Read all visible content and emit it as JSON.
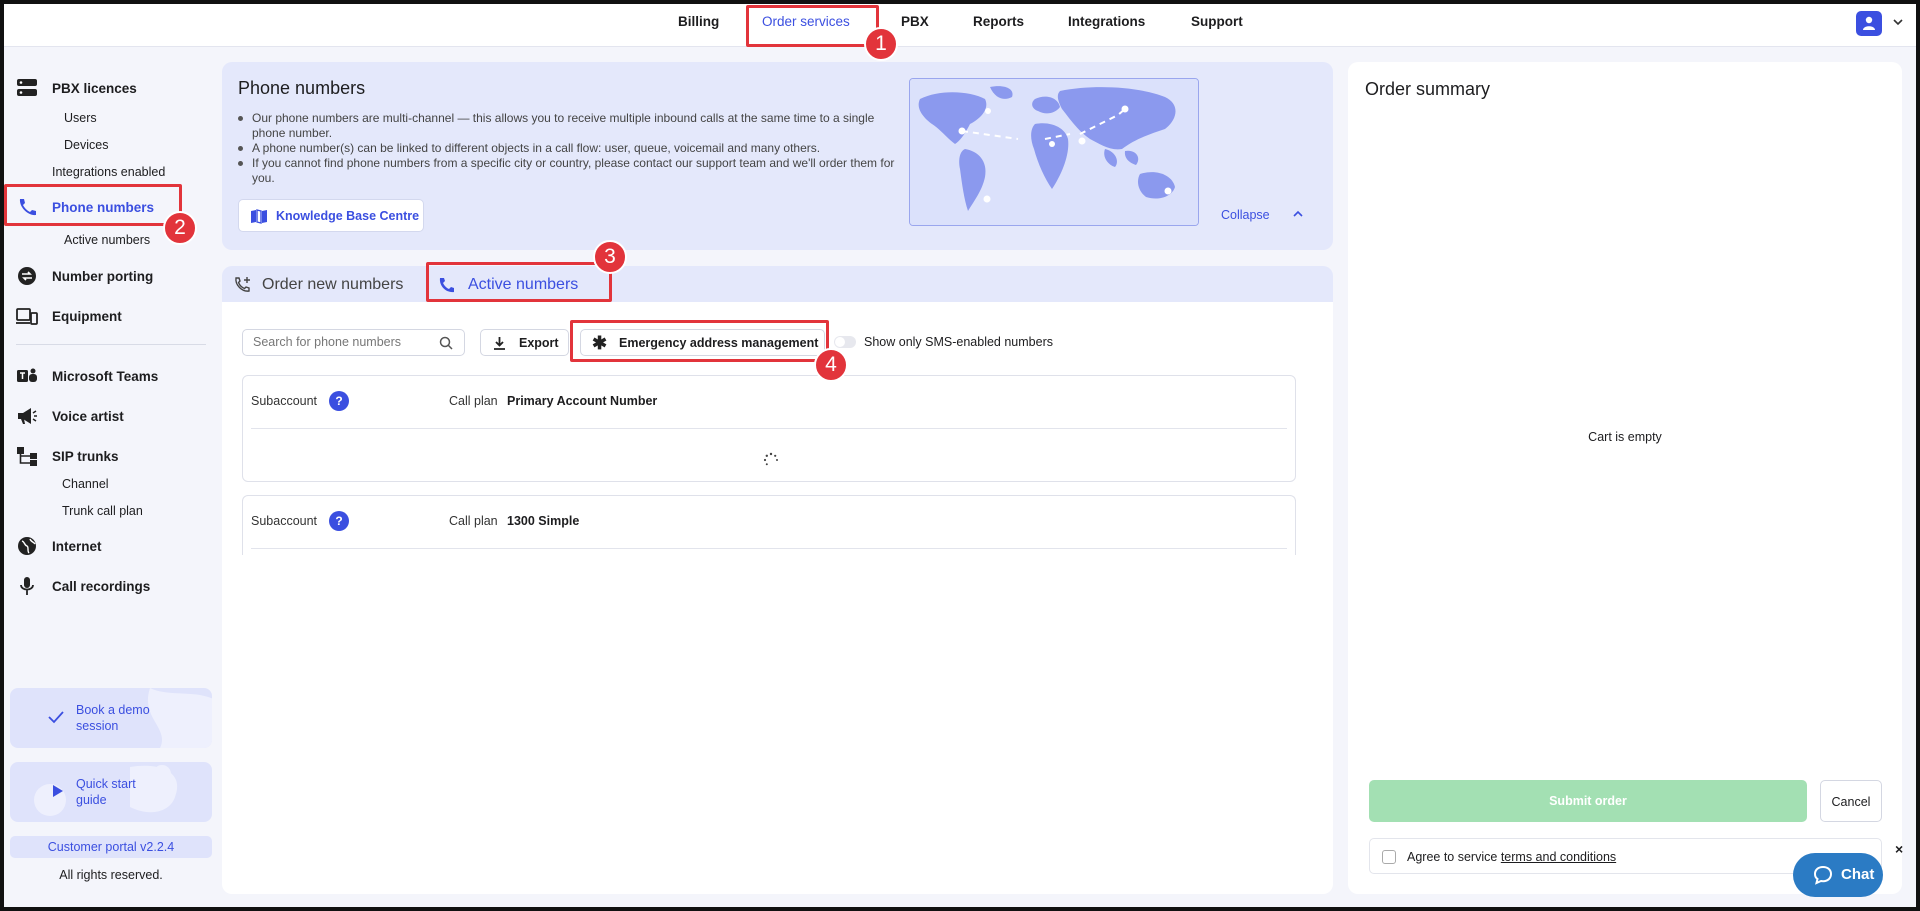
{
  "nav": {
    "items": [
      {
        "label": "Billing"
      },
      {
        "label": "Order services"
      },
      {
        "label": "PBX"
      },
      {
        "label": "Reports"
      },
      {
        "label": "Integrations"
      },
      {
        "label": "Support"
      }
    ]
  },
  "sidebar": {
    "pbx_licences": "PBX licences",
    "users": "Users",
    "devices": "Devices",
    "integrations_enabled": "Integrations enabled",
    "phone_numbers": "Phone numbers",
    "active_numbers": "Active numbers",
    "number_porting": "Number porting",
    "equipment": "Equipment",
    "microsoft_teams": "Microsoft Teams",
    "voice_artist": "Voice artist",
    "sip_trunks": "SIP trunks",
    "channel": "Channel",
    "trunk_call_plan": "Trunk call plan",
    "internet": "Internet",
    "call_recordings": "Call recordings",
    "book_demo_1": "Book a demo",
    "book_demo_2": "session",
    "quick_start_1": "Quick start",
    "quick_start_2": "guide",
    "version": "Customer portal v2.2.4",
    "rights": "All rights reserved."
  },
  "info": {
    "title": "Phone numbers",
    "bullets": [
      "Our phone numbers are multi-channel — this allows you to receive multiple inbound calls at the same time to a single phone number.",
      "A phone number(s) can be linked to different objects in a call flow: user, queue, voicemail and many others.",
      "If you cannot find phone numbers from a specific city or country, please contact our support team and we'll order them for you."
    ],
    "kb_button": "Knowledge Base Centre",
    "collapse": "Collapse"
  },
  "tabs": {
    "order_new": "Order new numbers",
    "active": "Active numbers"
  },
  "toolbar": {
    "search_placeholder": "Search for phone numbers",
    "export": "Export",
    "emergency": "Emergency address management",
    "sms_toggle": "Show only SMS-enabled numbers"
  },
  "groups": [
    {
      "subaccount": "Subaccount",
      "help": "?",
      "call_plan_label": "Call plan",
      "call_plan": "Primary Account Number"
    },
    {
      "subaccount": "Subaccount",
      "help": "?",
      "call_plan_label": "Call plan",
      "call_plan": "1300 Simple"
    }
  ],
  "summary": {
    "title": "Order summary",
    "empty": "Cart is empty",
    "submit": "Submit order",
    "cancel": "Cancel",
    "agree_prefix": "Agree to service",
    "agree_link": "terms and conditions"
  },
  "chat": {
    "label": "Chat",
    "close": "×"
  },
  "annotations": [
    "1",
    "2",
    "3",
    "4"
  ],
  "colors": {
    "accent": "#3b4fe0",
    "highlight": "#e2343b",
    "submit_disabled": "#a3e0b3",
    "chat": "#2b7bc4"
  }
}
